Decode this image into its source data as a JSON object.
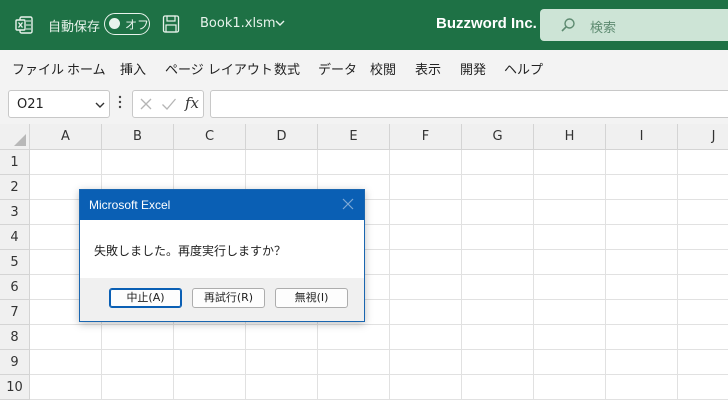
{
  "titlebar": {
    "autosave_label": "自動保存",
    "autosave_state": "オフ",
    "filename": "Book1.xlsm",
    "company": "Buzzword Inc.",
    "search_placeholder": "検索"
  },
  "menu": {
    "items": [
      "ファイル",
      "ホーム",
      "挿入",
      "ページ レイアウト",
      "数式",
      "データ",
      "校閲",
      "表示",
      "開発",
      "ヘルプ"
    ]
  },
  "formula_bar": {
    "name_box": "O21",
    "fx_label": "fx",
    "formula": ""
  },
  "sheet": {
    "columns": [
      "A",
      "B",
      "C",
      "D",
      "E",
      "F",
      "G",
      "H",
      "I",
      "J"
    ],
    "rows": [
      "1",
      "2",
      "3",
      "4",
      "5",
      "6",
      "7",
      "8",
      "9",
      "10"
    ]
  },
  "dialog": {
    "title": "Microsoft Excel",
    "message": "失敗しました。再度実行しますか？",
    "buttons": [
      "中止(A)",
      "再試行(R)",
      "無視(I)"
    ]
  },
  "colors": {
    "titlebar": "#1e7145",
    "dialog_title": "#0a5fb4",
    "menu_bg": "#f3f3f3",
    "header_bg": "#f0f0f0"
  }
}
